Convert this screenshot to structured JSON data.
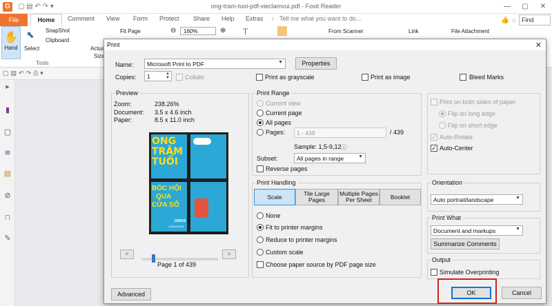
{
  "app": {
    "window_title": "ong-tram-tuoi-pdf-vieclamvui.pdf - Foxit Reader",
    "tabs": [
      "File",
      "Home",
      "Comment",
      "View",
      "Form",
      "Protect",
      "Share",
      "Help",
      "Extras"
    ],
    "tell_me": "Tell me what you want to do...",
    "find_placeholder": "Find",
    "ribbon": {
      "hand": "Hand",
      "select": "Select",
      "snapshot": "SnapShot",
      "clipboard": "Clipboard",
      "actual": "Actual",
      "size": "Size",
      "fit_page": "Fit Page",
      "zoom": "160%",
      "from_scanner": "From Scanner",
      "link": "Link",
      "file_attachment": "File Attachment",
      "tools_group": "Tools"
    }
  },
  "dialog": {
    "title": "Print",
    "name_label": "Name:",
    "printer": "Microsoft Print to PDF",
    "properties": "Properties",
    "copies_label": "Copies:",
    "copies": "1",
    "collate": "Collate",
    "print_grayscale": "Print as grayscale",
    "print_image": "Print as image",
    "bleed_marks": "Bleed Marks",
    "preview": {
      "title": "Preview",
      "zoom_label": "Zoom:",
      "zoom": "238.26%",
      "document_label": "Document:",
      "document": "3.5 x 4.6 inch",
      "paper_label": "Paper:",
      "paper": "8.5 x 11.0 inch",
      "page_indicator": "Page 1 of 439",
      "cover_text": [
        "ONG",
        "TRĂM",
        "TUỔI",
        "BÓC HỘI",
        "QUA",
        "CỬA SỔ",
        "JONAS",
        "JONASSON"
      ]
    },
    "print_range": {
      "title": "Print Range",
      "current_view": "Current view",
      "current_page": "Current page",
      "all_pages": "All pages",
      "pages": "Pages:",
      "pages_value": "1 - 439",
      "pages_total": "/ 439",
      "sample": "Sample: 1,5-9,12",
      "subset_label": "Subset:",
      "subset": "All pages in range",
      "reverse": "Reverse pages"
    },
    "print_handling": {
      "title": "Print Handling",
      "segments": [
        "Scale",
        "Tile Large Pages",
        "Multiple Pages Per Sheet",
        "Booklet"
      ],
      "none": "None",
      "fit": "Fit to printer margins",
      "reduce": "Reduce to printer margins",
      "custom": "Custom scale",
      "choose_source": "Choose paper source by PDF page size"
    },
    "duplex": {
      "both_sides": "Print on both sides of paper",
      "long_edge": "Flip on long edge",
      "short_edge": "Flip on short edge",
      "auto_rotate": "Auto-Rotate",
      "auto_center": "Auto-Center"
    },
    "orientation": {
      "title": "Orientation",
      "value": "Auto portrait/landscape"
    },
    "print_what": {
      "title": "Print What",
      "value": "Document and markups",
      "summarize": "Summarize Comments"
    },
    "output": {
      "title": "Output",
      "simulate": "Simulate Overprinting"
    },
    "advanced": "Advanced",
    "ok": "OK",
    "cancel": "Cancel"
  }
}
